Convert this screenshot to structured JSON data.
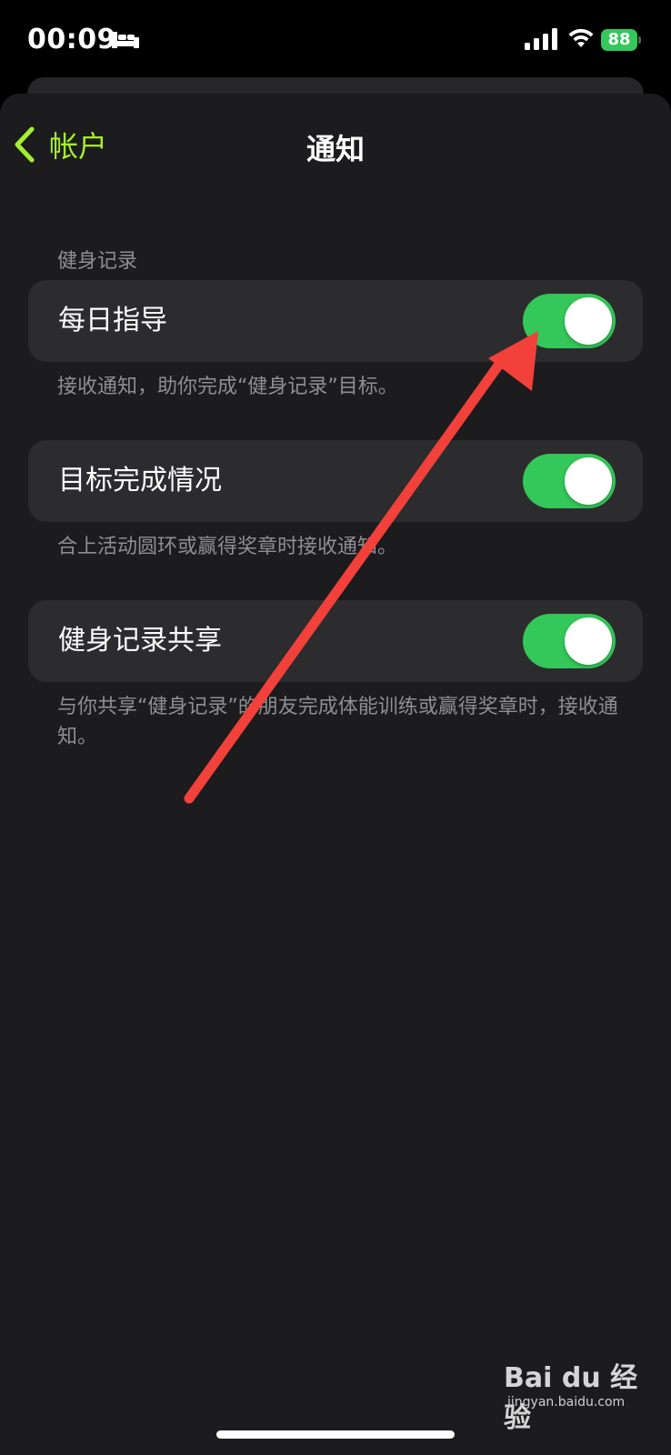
{
  "status_bar": {
    "time": "00:09",
    "battery_level": "88",
    "battery_color": "#34c759",
    "icons": [
      "bed-icon",
      "signal-icon",
      "wifi-icon",
      "battery-icon"
    ]
  },
  "nav": {
    "back_label": "帐户",
    "title": "通知",
    "accent_color": "#a4ef2d"
  },
  "section": {
    "header": "健身记录"
  },
  "settings": [
    {
      "label": "每日指导",
      "enabled": true,
      "footer": "接收通知，助你完成“健身记录”目标。"
    },
    {
      "label": "目标完成情况",
      "enabled": true,
      "footer": "合上活动圆环或赢得奖章时接收通知。"
    },
    {
      "label": "健身记录共享",
      "enabled": true,
      "footer": "与你共享“健身记录”的朋友完成体能训练或赢得奖章时，接收通知。"
    }
  ],
  "toggle_on_color": "#34c759",
  "annotation": {
    "arrow_color": "#f2413a"
  },
  "watermark": {
    "logo_text": "Bai du 经验",
    "url": "jingyan.baidu.com"
  }
}
